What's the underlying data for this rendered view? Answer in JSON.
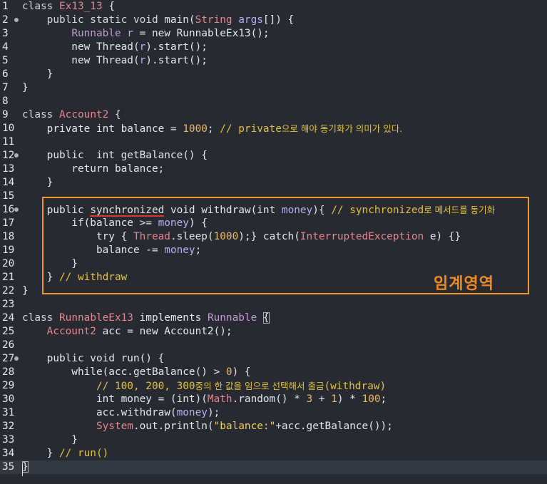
{
  "editor": {
    "line_numbers": [
      "1",
      "2",
      "3",
      "4",
      "5",
      "6",
      "7",
      "8",
      "9",
      "10",
      "11",
      "12",
      "13",
      "14",
      "15",
      "16",
      "17",
      "18",
      "19",
      "20",
      "21",
      "22",
      "23",
      "24",
      "25",
      "26",
      "27",
      "28",
      "29",
      "30",
      "31",
      "32",
      "33",
      "34",
      "35"
    ]
  },
  "code": {
    "l1_class_name": "Ex13_13",
    "l2_args": "args",
    "l3_type": "Runnable",
    "l3_var": "r",
    "l3_ctor": "RunnableEx13",
    "l4_new": "new",
    "l9_class_name": "Account2",
    "l10_value": "1000",
    "l10_comment_en": "// private",
    "l10_comment_ko": "으로 해야 동기화가 의미가 있다.",
    "l16_sync": "synchronized",
    "l16_comment_en": "// synchronized",
    "l16_comment_ko": "로 메서드를 동기화",
    "l17_money": "money",
    "l18_thread": "Thread",
    "l18_num": "1000",
    "l18_exc": "InterruptedException",
    "l21_comment": "// withdraw",
    "l24_class_name": "RunnableEx13",
    "l24_iface": "Runnable",
    "l25_type": "Account2",
    "l28_num": "0",
    "l29_comment_en": "// 100, 200, 300",
    "l29_comment_ko": "중의 한 값을 임으로 선택해서 출금",
    "l29_comment_tail": "(withdraw)",
    "l30_math": "Math",
    "l30_n1": "3",
    "l30_n2": "1",
    "l30_n3": "100",
    "l31_arg": "money",
    "l32_system": "System",
    "l32_string": "\"balance:\"",
    "l34_comment": "// run()"
  },
  "annotation": {
    "label": "임계영역",
    "color": "#f0962f"
  }
}
